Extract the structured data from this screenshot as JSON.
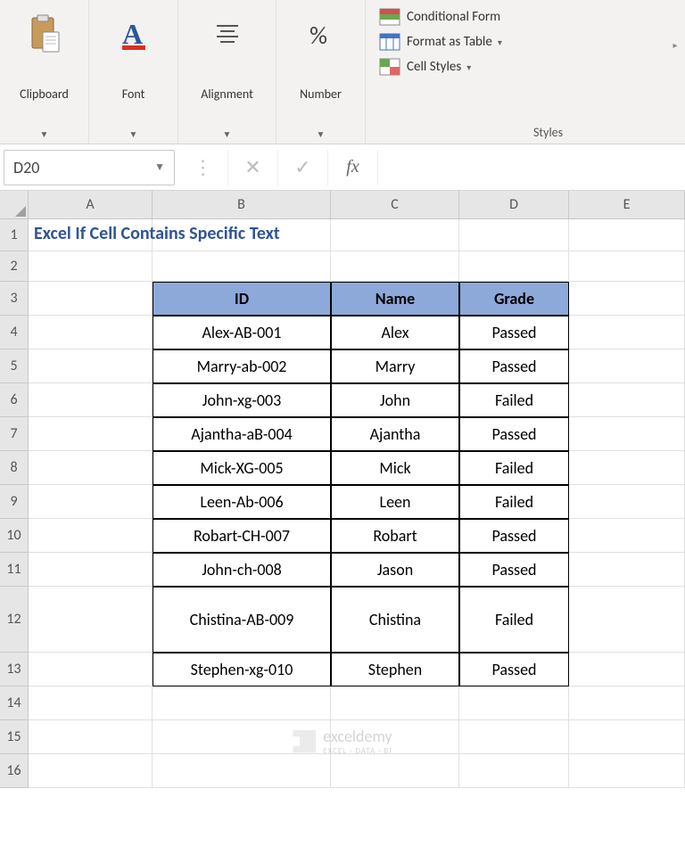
{
  "ribbon": {
    "clipboard_label": "Clipboard",
    "font_label": "Font",
    "alignment_label": "Alignment",
    "number_label": "Number",
    "conditional_label": "Conditional Form",
    "format_table_label": "Format as Table",
    "cell_styles_label": "Cell Styles",
    "styles_group_label": "Styles"
  },
  "formula_bar": {
    "name_box": "D20",
    "fx_label": "fx",
    "formula_value": ""
  },
  "columns": [
    "A",
    "B",
    "C",
    "D",
    "E"
  ],
  "row_numbers": [
    "1",
    "2",
    "3",
    "4",
    "5",
    "6",
    "7",
    "8",
    "9",
    "10",
    "11",
    "12",
    "13",
    "14",
    "15",
    "16"
  ],
  "selected_cell": "D20",
  "title": "Excel If Cell Contains Specific Text",
  "table": {
    "headers": {
      "id": "ID",
      "name": "Name",
      "grade": "Grade"
    },
    "rows": [
      {
        "id": "Alex-AB-001",
        "name": "Alex",
        "grade": "Passed"
      },
      {
        "id": "Marry-ab-002",
        "name": "Marry",
        "grade": "Passed"
      },
      {
        "id": "John-xg-003",
        "name": "John",
        "grade": "Failed"
      },
      {
        "id": "Ajantha-aB-004",
        "name": "Ajantha",
        "grade": "Passed"
      },
      {
        "id": "Mick-XG-005",
        "name": "Mick",
        "grade": "Failed"
      },
      {
        "id": "Leen-Ab-006",
        "name": "Leen",
        "grade": "Failed"
      },
      {
        "id": "Robart-CH-007",
        "name": "Robart",
        "grade": "Passed"
      },
      {
        "id": "John-ch-008",
        "name": "Jason",
        "grade": "Passed"
      },
      {
        "id": "Chistina-AB-009",
        "name": "Chistina",
        "grade": "Failed"
      },
      {
        "id": "Stephen-xg-010",
        "name": "Stephen",
        "grade": "Passed"
      }
    ]
  },
  "watermark": {
    "brand": "exceldemy",
    "sub": "EXCEL · DATA · BI"
  }
}
